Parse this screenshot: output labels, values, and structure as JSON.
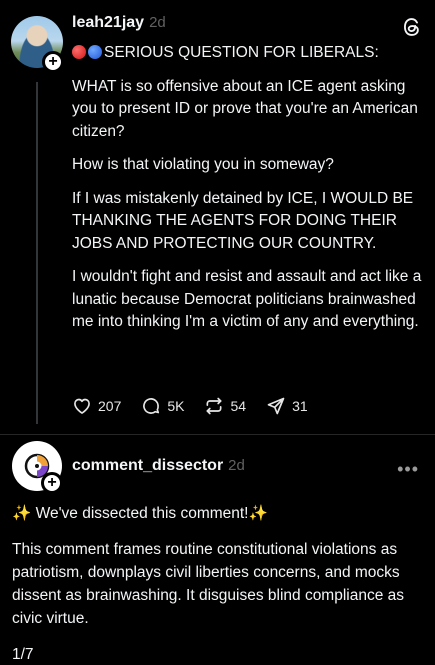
{
  "post": {
    "username": "leah21jay",
    "time": "2d",
    "title": "SERIOUS QUESTION FOR LIBERALS:",
    "paragraphs": [
      "WHAT is so offensive about an ICE agent asking you to present ID or prove that you're an American citizen?",
      "How is that violating you in someway?",
      "If I was mistakenly detained by ICE, I WOULD BE THANKING THE AGENTS FOR DOING THEIR JOBS AND PROTECTING OUR COUNTRY.",
      "I wouldn't fight and resist and assault and act like a lunatic because Democrat politicians brainwashed me into thinking I'm a victim of any and everything."
    ],
    "likes": "207",
    "replies": "5K",
    "reposts": "54",
    "shares": "31"
  },
  "reply": {
    "username": "comment_dissector",
    "time": "2d",
    "headline": "We've dissected this comment!",
    "sparkle": "✨",
    "body": "This comment frames routine constitutional violations as patriotism, downplays civil liberties concerns, and mocks dissent as brainwashing. It disguises blind compliance as civic virtue.",
    "page": "1/7"
  },
  "icons": {
    "threads": "threads-icon",
    "like": "heart-icon",
    "reply": "comment-icon",
    "repost": "repost-icon",
    "share": "send-icon",
    "more": "more-icon"
  }
}
